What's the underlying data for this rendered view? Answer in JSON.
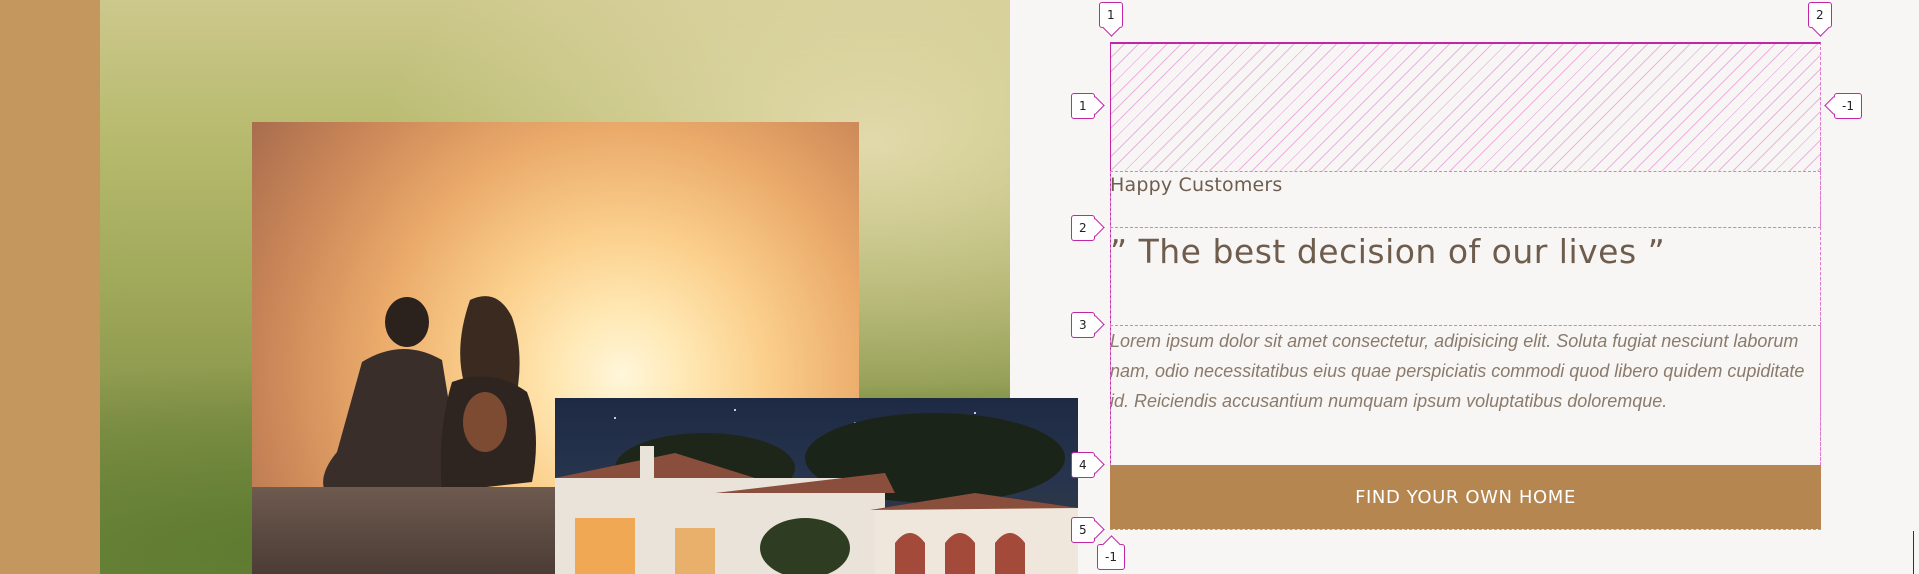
{
  "hero": {
    "subtitle": "Happy Customers",
    "headline": "” The best decision of our lives ”",
    "body": "Lorem ipsum dolor sit amet consectetur, adipisicing elit. Soluta fugiat nesciunt laborum nam, odio necessitatibus eius quae perspiciatis commodi quod libero quidem cupiditate id. Reiciendis accusantium numquam ipsum voluptatibus doloremque.",
    "cta_label": "FIND YOUR OWN HOME"
  },
  "grid_overlay": {
    "column_markers": [
      "1",
      "2"
    ],
    "row_markers": [
      "1",
      "2",
      "3",
      "4",
      "5"
    ],
    "row_end_marker": "-1",
    "column_end_marker": "-1",
    "color": "#c026a6"
  },
  "images": {
    "background": "hillside-landscape",
    "main": "couple-sunset",
    "secondary": "villa-at-night"
  },
  "colors": {
    "accent": "#b58650",
    "text": "#6e5d4d",
    "page_bg": "#f8f6f5",
    "side_strip": "#c4975f"
  }
}
